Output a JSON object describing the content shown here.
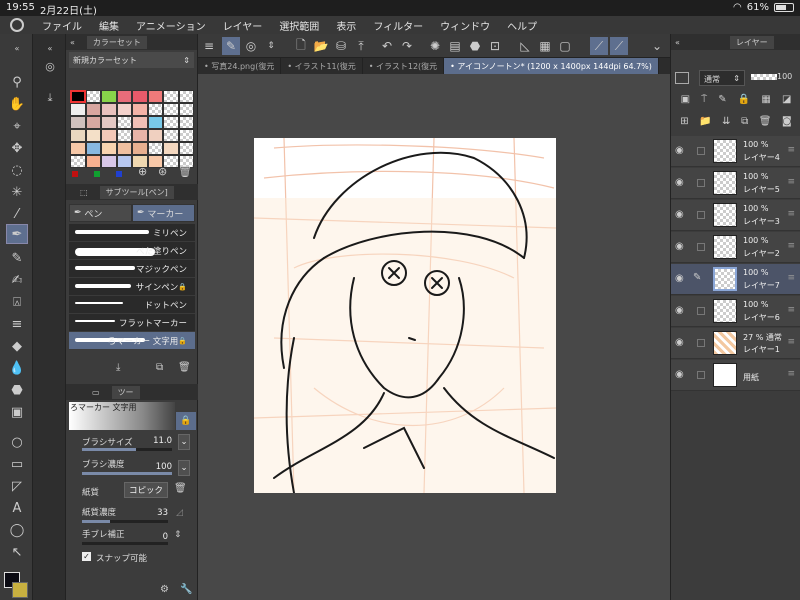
{
  "status": {
    "time": "19:55",
    "date": "2月22日(土)",
    "battery": "61%"
  },
  "menu": [
    "ファイル",
    "編集",
    "アニメーション",
    "レイヤー",
    "選択範囲",
    "表示",
    "フィルター",
    "ウィンドウ",
    "ヘルプ"
  ],
  "colorset": {
    "tab_label": "カラーセット",
    "set_name": "新規カラーセット",
    "swatches": [
      "#000000",
      "checker",
      "#88d44a",
      "#e86c7a",
      "#e85a6a",
      "#f07a7a",
      "checker",
      "checker",
      "#eeeeee",
      "#d9a6a0",
      "#e8c2be",
      "#f3d2cc",
      "#f4b4a8",
      "checker",
      "checker",
      "checker",
      "#cfc0bd",
      "#d8a8a2",
      "#e3c8c4",
      "checker",
      "#f0c0b6",
      "#79c9e8",
      "checker",
      "checker",
      "#e9d8c0",
      "#f4e0c8",
      "#f3c8b8",
      "checker",
      "#e8b4a8",
      "#f0d0c0",
      "checker",
      "checker",
      "#f6c8a8",
      "#88b8e0",
      "#f8d4b0",
      "#f0c0a0",
      "#e8b090",
      "checker",
      "#f4d8c0",
      "checker",
      "checker",
      "#f8b090",
      "#d8c8e8",
      "#b8c8f0",
      "#f0d8b0",
      "#f8c8a8",
      "checker",
      "checker"
    ],
    "bottom_colors": [
      "#c01010",
      "#10a030",
      "#2040d0"
    ]
  },
  "subtool": {
    "tab_label": "サブツール[ペン]",
    "tabs": [
      "ペン",
      "マーカー"
    ],
    "brushes": [
      {
        "name": "ミリペン",
        "locked": false
      },
      {
        "name": "べた塗りペン",
        "locked": false
      },
      {
        "name": "マジックペン",
        "locked": false
      },
      {
        "name": "サインペン",
        "locked": true
      },
      {
        "name": "ドットペン",
        "locked": false
      },
      {
        "name": "フラットマーカー",
        "locked": false
      },
      {
        "name": "ろマーカー 文字用",
        "locked": true
      }
    ]
  },
  "tool_property": {
    "tab_label": "ツー",
    "title": "ろマーカー 文字用",
    "props": [
      {
        "label": "ブラシサイズ",
        "value": "11.0"
      },
      {
        "label": "ブラシ濃度",
        "value": "100"
      },
      {
        "label": "紙質",
        "value": "コピック"
      },
      {
        "label": "紙質濃度",
        "value": "33"
      },
      {
        "label": "手ブレ補正",
        "value": "0"
      }
    ],
    "snap_label": "スナップ可能"
  },
  "doc_tabs": [
    {
      "label": "写真24.png(復元",
      "selected": false
    },
    {
      "label": "イラスト11(復元",
      "selected": false
    },
    {
      "label": "イラスト12(復元",
      "selected": false
    },
    {
      "label": "アイコンノートン* (1200 x 1400px 144dpi 64.7%)",
      "selected": true
    }
  ],
  "layers_panel": {
    "tab_label": "レイヤー",
    "blend_mode": "通常",
    "opacity": "100",
    "layers": [
      {
        "opacity": "100 %",
        "name": "レイヤー4",
        "thumb": "checker",
        "selected": false
      },
      {
        "opacity": "100 %",
        "name": "レイヤー5",
        "thumb": "checker",
        "selected": false
      },
      {
        "opacity": "100 %",
        "name": "レイヤー3",
        "thumb": "checker",
        "selected": false
      },
      {
        "opacity": "100 %",
        "name": "レイヤー2",
        "thumb": "checker",
        "selected": false
      },
      {
        "opacity": "100 %",
        "name": "レイヤー7",
        "thumb": "checker",
        "selected": true
      },
      {
        "opacity": "100 %",
        "name": "レイヤー6",
        "thumb": "checker",
        "selected": false
      },
      {
        "opacity": "27 %",
        "name": "レイヤー1",
        "thumb": "sketch",
        "selected": false,
        "blend": "通常"
      },
      {
        "opacity": "",
        "name": "用紙",
        "thumb": "#ffffff",
        "selected": false
      }
    ]
  },
  "colors": {
    "accent": "#5c6d8c",
    "main_color": "#0a0a12",
    "sub_color": "#c8b040"
  }
}
